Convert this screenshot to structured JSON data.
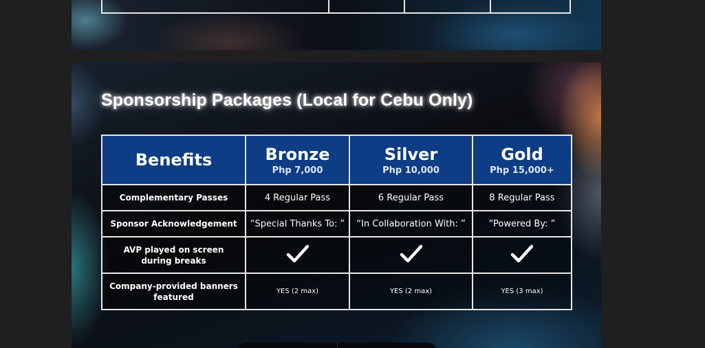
{
  "slide": {
    "title": "Sponsorship Packages (Local for Cebu Only)"
  },
  "table": {
    "header": {
      "benefits": "Benefits",
      "tiers": [
        {
          "name": "Bronze",
          "price": "Php 7,000"
        },
        {
          "name": "Silver",
          "price": "Php 10,000"
        },
        {
          "name": "Gold",
          "price": "Php 15,000+"
        }
      ]
    },
    "rows": [
      {
        "label": "Complementary Passes",
        "values": [
          "4 Regular Pass",
          "6 Regular Pass",
          "8 Regular Pass"
        ]
      },
      {
        "label": "Sponsor Acknowledgement",
        "values": [
          "“Special Thanks To: ”",
          "“In Collaboration With: ”",
          "“Powered By: ”"
        ]
      },
      {
        "label": "AVP played on screen during breaks",
        "values": [
          "check-icon",
          "check-icon",
          "check-icon"
        ]
      },
      {
        "label": "Company-provided banners featured",
        "values": [
          "YES (2 max)",
          "YES (2 max)",
          "YES (3 max)"
        ]
      }
    ]
  },
  "colors": {
    "header_blue": "#0c3d85",
    "page_background": "#1f1f1f",
    "border": "#e8e8e8"
  }
}
